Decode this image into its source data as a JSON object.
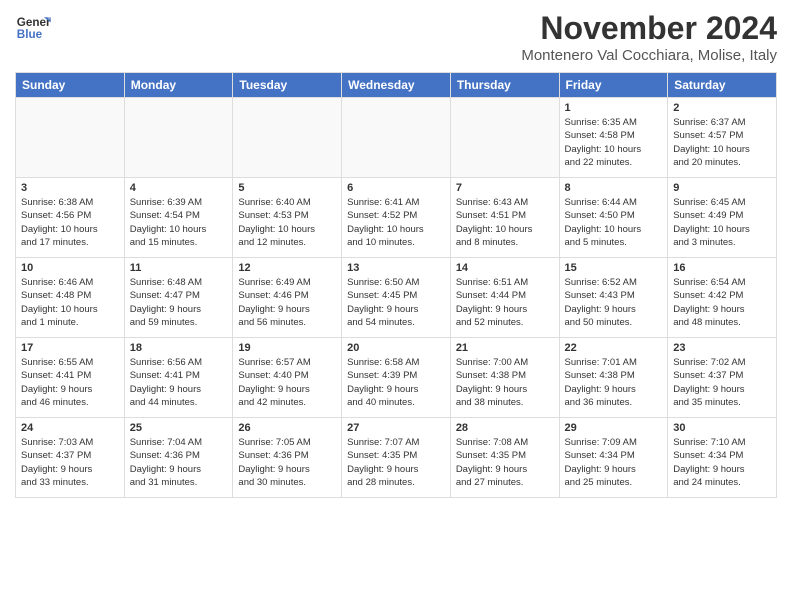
{
  "header": {
    "logo_line1": "General",
    "logo_line2": "Blue",
    "month": "November 2024",
    "location": "Montenero Val Cocchiara, Molise, Italy"
  },
  "weekdays": [
    "Sunday",
    "Monday",
    "Tuesday",
    "Wednesday",
    "Thursday",
    "Friday",
    "Saturday"
  ],
  "weeks": [
    [
      {
        "day": "",
        "info": ""
      },
      {
        "day": "",
        "info": ""
      },
      {
        "day": "",
        "info": ""
      },
      {
        "day": "",
        "info": ""
      },
      {
        "day": "",
        "info": ""
      },
      {
        "day": "1",
        "info": "Sunrise: 6:35 AM\nSunset: 4:58 PM\nDaylight: 10 hours\nand 22 minutes."
      },
      {
        "day": "2",
        "info": "Sunrise: 6:37 AM\nSunset: 4:57 PM\nDaylight: 10 hours\nand 20 minutes."
      }
    ],
    [
      {
        "day": "3",
        "info": "Sunrise: 6:38 AM\nSunset: 4:56 PM\nDaylight: 10 hours\nand 17 minutes."
      },
      {
        "day": "4",
        "info": "Sunrise: 6:39 AM\nSunset: 4:54 PM\nDaylight: 10 hours\nand 15 minutes."
      },
      {
        "day": "5",
        "info": "Sunrise: 6:40 AM\nSunset: 4:53 PM\nDaylight: 10 hours\nand 12 minutes."
      },
      {
        "day": "6",
        "info": "Sunrise: 6:41 AM\nSunset: 4:52 PM\nDaylight: 10 hours\nand 10 minutes."
      },
      {
        "day": "7",
        "info": "Sunrise: 6:43 AM\nSunset: 4:51 PM\nDaylight: 10 hours\nand 8 minutes."
      },
      {
        "day": "8",
        "info": "Sunrise: 6:44 AM\nSunset: 4:50 PM\nDaylight: 10 hours\nand 5 minutes."
      },
      {
        "day": "9",
        "info": "Sunrise: 6:45 AM\nSunset: 4:49 PM\nDaylight: 10 hours\nand 3 minutes."
      }
    ],
    [
      {
        "day": "10",
        "info": "Sunrise: 6:46 AM\nSunset: 4:48 PM\nDaylight: 10 hours\nand 1 minute."
      },
      {
        "day": "11",
        "info": "Sunrise: 6:48 AM\nSunset: 4:47 PM\nDaylight: 9 hours\nand 59 minutes."
      },
      {
        "day": "12",
        "info": "Sunrise: 6:49 AM\nSunset: 4:46 PM\nDaylight: 9 hours\nand 56 minutes."
      },
      {
        "day": "13",
        "info": "Sunrise: 6:50 AM\nSunset: 4:45 PM\nDaylight: 9 hours\nand 54 minutes."
      },
      {
        "day": "14",
        "info": "Sunrise: 6:51 AM\nSunset: 4:44 PM\nDaylight: 9 hours\nand 52 minutes."
      },
      {
        "day": "15",
        "info": "Sunrise: 6:52 AM\nSunset: 4:43 PM\nDaylight: 9 hours\nand 50 minutes."
      },
      {
        "day": "16",
        "info": "Sunrise: 6:54 AM\nSunset: 4:42 PM\nDaylight: 9 hours\nand 48 minutes."
      }
    ],
    [
      {
        "day": "17",
        "info": "Sunrise: 6:55 AM\nSunset: 4:41 PM\nDaylight: 9 hours\nand 46 minutes."
      },
      {
        "day": "18",
        "info": "Sunrise: 6:56 AM\nSunset: 4:41 PM\nDaylight: 9 hours\nand 44 minutes."
      },
      {
        "day": "19",
        "info": "Sunrise: 6:57 AM\nSunset: 4:40 PM\nDaylight: 9 hours\nand 42 minutes."
      },
      {
        "day": "20",
        "info": "Sunrise: 6:58 AM\nSunset: 4:39 PM\nDaylight: 9 hours\nand 40 minutes."
      },
      {
        "day": "21",
        "info": "Sunrise: 7:00 AM\nSunset: 4:38 PM\nDaylight: 9 hours\nand 38 minutes."
      },
      {
        "day": "22",
        "info": "Sunrise: 7:01 AM\nSunset: 4:38 PM\nDaylight: 9 hours\nand 36 minutes."
      },
      {
        "day": "23",
        "info": "Sunrise: 7:02 AM\nSunset: 4:37 PM\nDaylight: 9 hours\nand 35 minutes."
      }
    ],
    [
      {
        "day": "24",
        "info": "Sunrise: 7:03 AM\nSunset: 4:37 PM\nDaylight: 9 hours\nand 33 minutes."
      },
      {
        "day": "25",
        "info": "Sunrise: 7:04 AM\nSunset: 4:36 PM\nDaylight: 9 hours\nand 31 minutes."
      },
      {
        "day": "26",
        "info": "Sunrise: 7:05 AM\nSunset: 4:36 PM\nDaylight: 9 hours\nand 30 minutes."
      },
      {
        "day": "27",
        "info": "Sunrise: 7:07 AM\nSunset: 4:35 PM\nDaylight: 9 hours\nand 28 minutes."
      },
      {
        "day": "28",
        "info": "Sunrise: 7:08 AM\nSunset: 4:35 PM\nDaylight: 9 hours\nand 27 minutes."
      },
      {
        "day": "29",
        "info": "Sunrise: 7:09 AM\nSunset: 4:34 PM\nDaylight: 9 hours\nand 25 minutes."
      },
      {
        "day": "30",
        "info": "Sunrise: 7:10 AM\nSunset: 4:34 PM\nDaylight: 9 hours\nand 24 minutes."
      }
    ]
  ]
}
